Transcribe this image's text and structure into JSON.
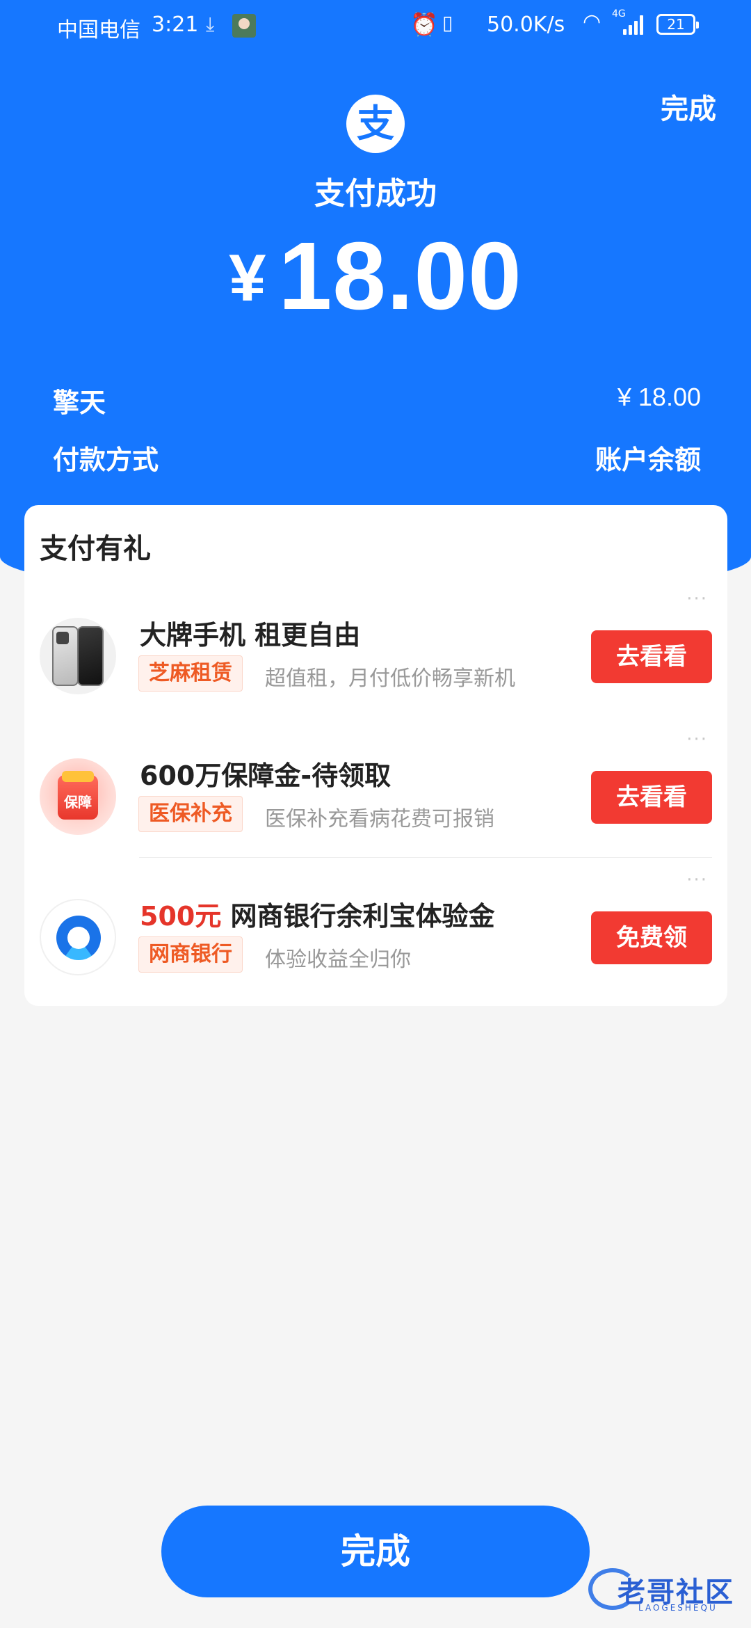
{
  "status_bar": {
    "carrier": "中国电信",
    "time": "3:21",
    "download_icon": "download-icon",
    "network_speed": "50.0K/s",
    "network_type": "4G",
    "battery": "21"
  },
  "header": {
    "done_label": "完成",
    "logo_char": "支",
    "title": "支付成功"
  },
  "amount": {
    "currency": "¥",
    "value": "18.00"
  },
  "details": {
    "payee": "擎天",
    "payee_amount": "¥ 18.00",
    "method_label": "付款方式",
    "method_value": "账户余额"
  },
  "promo": {
    "title": "支付有礼",
    "more_glyph": "···",
    "items": [
      {
        "title": "大牌手机 租更自由",
        "tag": "芝麻租赁",
        "desc": "超值租，月付低价畅享新机",
        "button": "去看看"
      },
      {
        "title": "600万保障金-待领取",
        "tag": "医保补充",
        "desc": "医保补充看病花费可报销",
        "button": "去看看",
        "thumb_text": "保障"
      },
      {
        "title_highlight": "500元",
        "title": " 网商银行余利宝体验金",
        "tag": "网商银行",
        "desc": "体验收益全归你",
        "button": "免费领"
      }
    ]
  },
  "footer": {
    "done_label": "完成"
  },
  "watermark": {
    "text": "老哥社区",
    "sub": "LAOGESHEQU"
  },
  "colors": {
    "brand_blue": "#1677ff",
    "button_red": "#f23a32",
    "tag_orange": "#ee5a24"
  }
}
